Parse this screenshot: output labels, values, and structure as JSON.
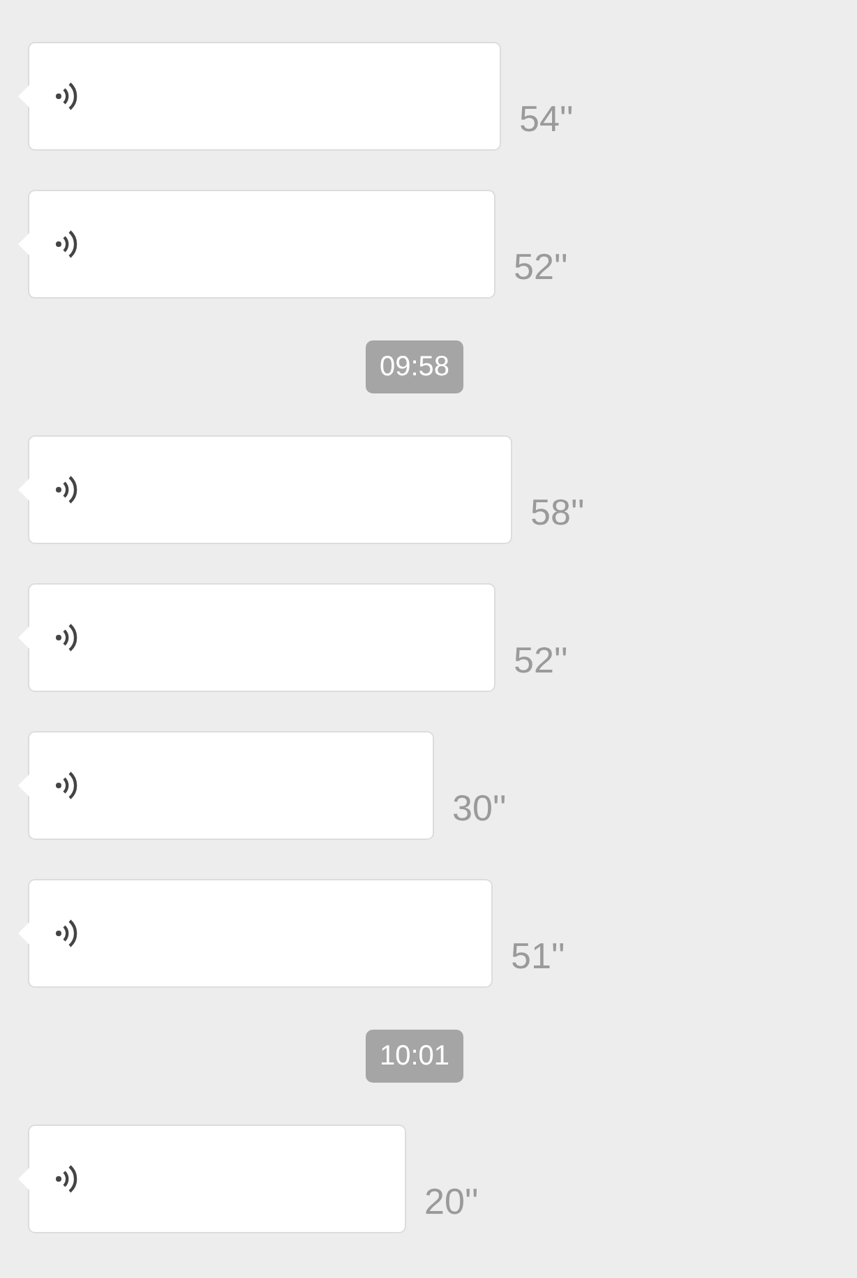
{
  "messages": [
    {
      "kind": "voice",
      "duration": "54''"
    },
    {
      "kind": "voice",
      "duration": "52''"
    },
    {
      "kind": "time",
      "text": "09:58"
    },
    {
      "kind": "voice",
      "duration": "58''"
    },
    {
      "kind": "voice",
      "duration": "52''"
    },
    {
      "kind": "voice",
      "duration": "30''"
    },
    {
      "kind": "voice",
      "duration": "51''"
    },
    {
      "kind": "time",
      "text": "10:01"
    },
    {
      "kind": "voice",
      "duration": "20''"
    }
  ]
}
